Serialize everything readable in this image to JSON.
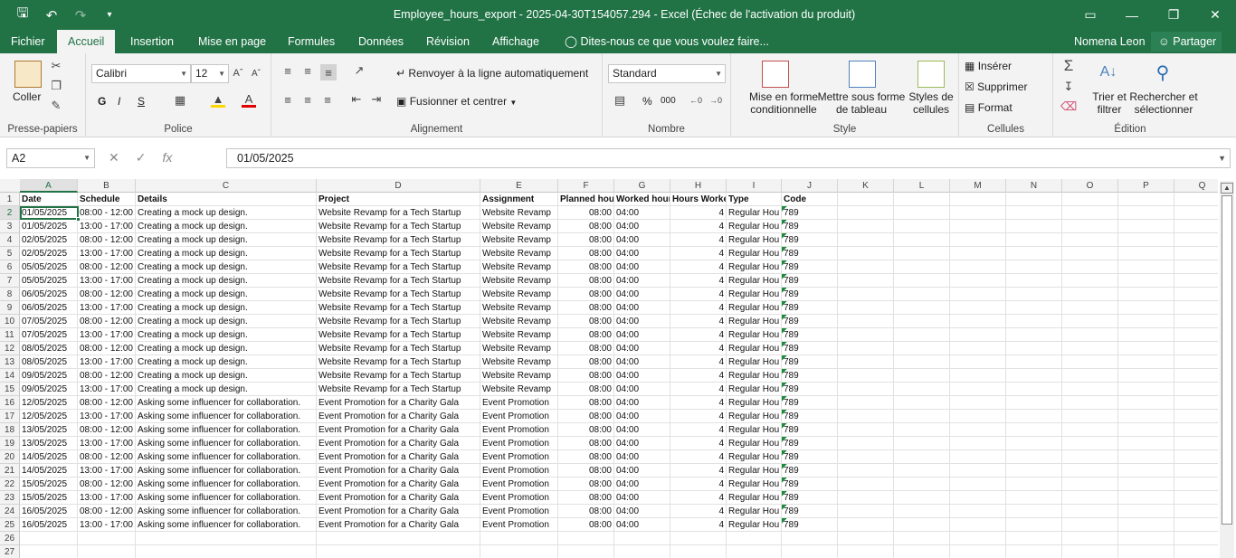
{
  "titlebar": {
    "title": "Employee_hours_export - 2025-04-30T154057.294 - Excel (Échec de l'activation du produit)",
    "qat_icons": [
      "save-icon",
      "undo-icon",
      "redo-icon",
      "customize-icon"
    ],
    "window_buttons": [
      "ribbon-display-icon",
      "minimize-icon",
      "restore-icon",
      "close-icon"
    ]
  },
  "menu": {
    "tabs": [
      "Fichier",
      "Accueil",
      "Insertion",
      "Mise en page",
      "Formules",
      "Données",
      "Révision",
      "Affichage"
    ],
    "active_tab": "Accueil",
    "tell_me": "Dites-nous ce que vous voulez faire...",
    "user": "Nomena Leon",
    "share": "Partager"
  },
  "ribbon": {
    "clipboard": {
      "label": "Presse-papiers",
      "paste": "Coller"
    },
    "font": {
      "label": "Police",
      "name": "Calibri",
      "size": "12",
      "bold": "G",
      "italic": "I",
      "underline": "S"
    },
    "alignment": {
      "label": "Alignement",
      "wrap": "Renvoyer à la ligne automatiquement",
      "merge": "Fusionner et centrer"
    },
    "number": {
      "label": "Nombre",
      "format": "Standard",
      "percent": "%",
      "thousands": "000"
    },
    "styles": {
      "label": "Style",
      "conditional_1": "Mise en forme",
      "conditional_2": "conditionnelle",
      "table_1": "Mettre sous forme",
      "table_2": "de tableau",
      "cell_1": "Styles de",
      "cell_2": "cellules"
    },
    "cells": {
      "label": "Cellules",
      "insert": "Insérer",
      "delete": "Supprimer",
      "format": "Format"
    },
    "editing": {
      "label": "Édition",
      "sort_1": "Trier et",
      "sort_2": "filtrer",
      "find_1": "Rechercher et",
      "find_2": "sélectionner"
    }
  },
  "formula_bar": {
    "name_box": "A2",
    "value": "01/05/2025"
  },
  "grid": {
    "columns": [
      "A",
      "B",
      "C",
      "D",
      "E",
      "F",
      "G",
      "H",
      "I",
      "J",
      "K",
      "L",
      "M",
      "N",
      "O",
      "P",
      "Q"
    ],
    "selected_cell": "A2",
    "headers": [
      "Date",
      "Schedule",
      "Details",
      "Project",
      "Assignment",
      "Planned hou",
      "Worked hour",
      "Hours Worke",
      "Type",
      "Code"
    ],
    "rows": [
      [
        "01/05/2025",
        "08:00 - 12:00",
        "Creating a mock up design.",
        "Website Revamp for a Tech Startup",
        "Website Revamp",
        "08:00",
        "04:00",
        "4",
        "Regular Hou",
        "789"
      ],
      [
        "01/05/2025",
        "13:00 - 17:00",
        "Creating a mock up design.",
        "Website Revamp for a Tech Startup",
        "Website Revamp",
        "08:00",
        "04:00",
        "4",
        "Regular Hou",
        "789"
      ],
      [
        "02/05/2025",
        "08:00 - 12:00",
        "Creating a mock up design.",
        "Website Revamp for a Tech Startup",
        "Website Revamp",
        "08:00",
        "04:00",
        "4",
        "Regular Hou",
        "789"
      ],
      [
        "02/05/2025",
        "13:00 - 17:00",
        "Creating a mock up design.",
        "Website Revamp for a Tech Startup",
        "Website Revamp",
        "08:00",
        "04:00",
        "4",
        "Regular Hou",
        "789"
      ],
      [
        "05/05/2025",
        "08:00 - 12:00",
        "Creating a mock up design.",
        "Website Revamp for a Tech Startup",
        "Website Revamp",
        "08:00",
        "04:00",
        "4",
        "Regular Hou",
        "789"
      ],
      [
        "05/05/2025",
        "13:00 - 17:00",
        "Creating a mock up design.",
        "Website Revamp for a Tech Startup",
        "Website Revamp",
        "08:00",
        "04:00",
        "4",
        "Regular Hou",
        "789"
      ],
      [
        "06/05/2025",
        "08:00 - 12:00",
        "Creating a mock up design.",
        "Website Revamp for a Tech Startup",
        "Website Revamp",
        "08:00",
        "04:00",
        "4",
        "Regular Hou",
        "789"
      ],
      [
        "06/05/2025",
        "13:00 - 17:00",
        "Creating a mock up design.",
        "Website Revamp for a Tech Startup",
        "Website Revamp",
        "08:00",
        "04:00",
        "4",
        "Regular Hou",
        "789"
      ],
      [
        "07/05/2025",
        "08:00 - 12:00",
        "Creating a mock up design.",
        "Website Revamp for a Tech Startup",
        "Website Revamp",
        "08:00",
        "04:00",
        "4",
        "Regular Hou",
        "789"
      ],
      [
        "07/05/2025",
        "13:00 - 17:00",
        "Creating a mock up design.",
        "Website Revamp for a Tech Startup",
        "Website Revamp",
        "08:00",
        "04:00",
        "4",
        "Regular Hou",
        "789"
      ],
      [
        "08/05/2025",
        "08:00 - 12:00",
        "Creating a mock up design.",
        "Website Revamp for a Tech Startup",
        "Website Revamp",
        "08:00",
        "04:00",
        "4",
        "Regular Hou",
        "789"
      ],
      [
        "08/05/2025",
        "13:00 - 17:00",
        "Creating a mock up design.",
        "Website Revamp for a Tech Startup",
        "Website Revamp",
        "08:00",
        "04:00",
        "4",
        "Regular Hou",
        "789"
      ],
      [
        "09/05/2025",
        "08:00 - 12:00",
        "Creating a mock up design.",
        "Website Revamp for a Tech Startup",
        "Website Revamp",
        "08:00",
        "04:00",
        "4",
        "Regular Hou",
        "789"
      ],
      [
        "09/05/2025",
        "13:00 - 17:00",
        "Creating a mock up design.",
        "Website Revamp for a Tech Startup",
        "Website Revamp",
        "08:00",
        "04:00",
        "4",
        "Regular Hou",
        "789"
      ],
      [
        "12/05/2025",
        "08:00 - 12:00",
        "Asking some influencer for collaboration.",
        "Event Promotion for a Charity Gala",
        "Event Promotion",
        "08:00",
        "04:00",
        "4",
        "Regular Hou",
        "789"
      ],
      [
        "12/05/2025",
        "13:00 - 17:00",
        "Asking some influencer for collaboration.",
        "Event Promotion for a Charity Gala",
        "Event Promotion",
        "08:00",
        "04:00",
        "4",
        "Regular Hou",
        "789"
      ],
      [
        "13/05/2025",
        "08:00 - 12:00",
        "Asking some influencer for collaboration.",
        "Event Promotion for a Charity Gala",
        "Event Promotion",
        "08:00",
        "04:00",
        "4",
        "Regular Hou",
        "789"
      ],
      [
        "13/05/2025",
        "13:00 - 17:00",
        "Asking some influencer for collaboration.",
        "Event Promotion for a Charity Gala",
        "Event Promotion",
        "08:00",
        "04:00",
        "4",
        "Regular Hou",
        "789"
      ],
      [
        "14/05/2025",
        "08:00 - 12:00",
        "Asking some influencer for collaboration.",
        "Event Promotion for a Charity Gala",
        "Event Promotion",
        "08:00",
        "04:00",
        "4",
        "Regular Hou",
        "789"
      ],
      [
        "14/05/2025",
        "13:00 - 17:00",
        "Asking some influencer for collaboration.",
        "Event Promotion for a Charity Gala",
        "Event Promotion",
        "08:00",
        "04:00",
        "4",
        "Regular Hou",
        "789"
      ],
      [
        "15/05/2025",
        "08:00 - 12:00",
        "Asking some influencer for collaboration.",
        "Event Promotion for a Charity Gala",
        "Event Promotion",
        "08:00",
        "04:00",
        "4",
        "Regular Hou",
        "789"
      ],
      [
        "15/05/2025",
        "13:00 - 17:00",
        "Asking some influencer for collaboration.",
        "Event Promotion for a Charity Gala",
        "Event Promotion",
        "08:00",
        "04:00",
        "4",
        "Regular Hou",
        "789"
      ],
      [
        "16/05/2025",
        "08:00 - 12:00",
        "Asking some influencer for collaboration.",
        "Event Promotion for a Charity Gala",
        "Event Promotion",
        "08:00",
        "04:00",
        "4",
        "Regular Hou",
        "789"
      ],
      [
        "16/05/2025",
        "13:00 - 17:00",
        "Asking some influencer for collaboration.",
        "Event Promotion for a Charity Gala",
        "Event Promotion",
        "08:00",
        "04:00",
        "4",
        "Regular Hou",
        "789"
      ]
    ],
    "row_numbers": [
      "1",
      "2",
      "3",
      "4",
      "5",
      "6",
      "7",
      "8",
      "9",
      "10",
      "11",
      "12",
      "13",
      "14",
      "15",
      "16",
      "17",
      "18",
      "19",
      "20",
      "21",
      "22",
      "23",
      "24",
      "25",
      "26",
      "27"
    ]
  },
  "colors": {
    "accent": "#217346",
    "error_triangle": "#1e8a3c"
  }
}
